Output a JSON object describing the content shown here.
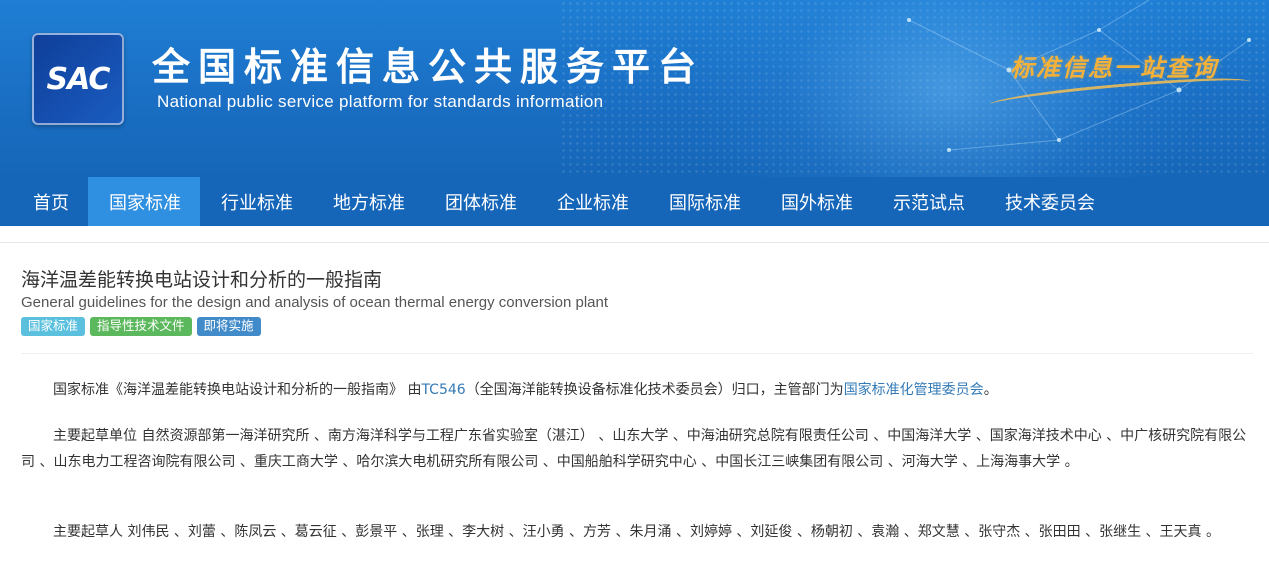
{
  "header": {
    "logo_text": "SAC",
    "title": "全国标准信息公共服务平台",
    "subtitle": "National public service platform  for standards information",
    "slogan": "标准信息一站查询"
  },
  "nav": {
    "items": [
      {
        "label": "首页",
        "active": false
      },
      {
        "label": "国家标准",
        "active": true
      },
      {
        "label": "行业标准",
        "active": false
      },
      {
        "label": "地方标准",
        "active": false
      },
      {
        "label": "团体标准",
        "active": false
      },
      {
        "label": "企业标准",
        "active": false
      },
      {
        "label": "国际标准",
        "active": false
      },
      {
        "label": "国外标准",
        "active": false
      },
      {
        "label": "示范试点",
        "active": false
      },
      {
        "label": "技术委员会",
        "active": false
      }
    ]
  },
  "standard": {
    "title_zh": "海洋温差能转换电站设计和分析的一般指南",
    "title_en": "General guidelines for the design and analysis of ocean thermal energy conversion plant",
    "tags": [
      {
        "label": "国家标准",
        "color": "#5bc0de"
      },
      {
        "label": "指导性技术文件",
        "color": "#5cb85c"
      },
      {
        "label": "即将实施",
        "color": "#428bca"
      }
    ],
    "intro": {
      "prefix": "国家标准《海洋温差能转换电站设计和分析的一般指南》 由",
      "tc_link": "TC546",
      "tc_name": "（全国海洋能转换设备标准化技术委员会）归口，主管部门为",
      "dept_link": "国家标准化管理委员会",
      "suffix": "。"
    },
    "drafting_units_label": "主要起草单位",
    "drafting_units": "自然资源部第一海洋研究所 、南方海洋科学与工程广东省实验室（湛江） 、山东大学 、中海油研究总院有限责任公司 、中国海洋大学 、国家海洋技术中心 、中广核研究院有限公司 、山东电力工程咨询院有限公司 、重庆工商大学 、哈尔滨大电机研究所有限公司 、中国船舶科学研究中心 、中国长江三峡集团有限公司 、河海大学 、上海海事大学 。",
    "drafters_label": "主要起草人",
    "drafters": "刘伟民 、刘蕾 、陈凤云 、葛云征 、彭景平 、张理 、李大树 、汪小勇 、方芳 、朱月涌 、刘婷婷 、刘延俊 、杨朝初 、袁瀚 、郑文慧 、张守杰 、张田田 、张继生 、王天真 。"
  }
}
